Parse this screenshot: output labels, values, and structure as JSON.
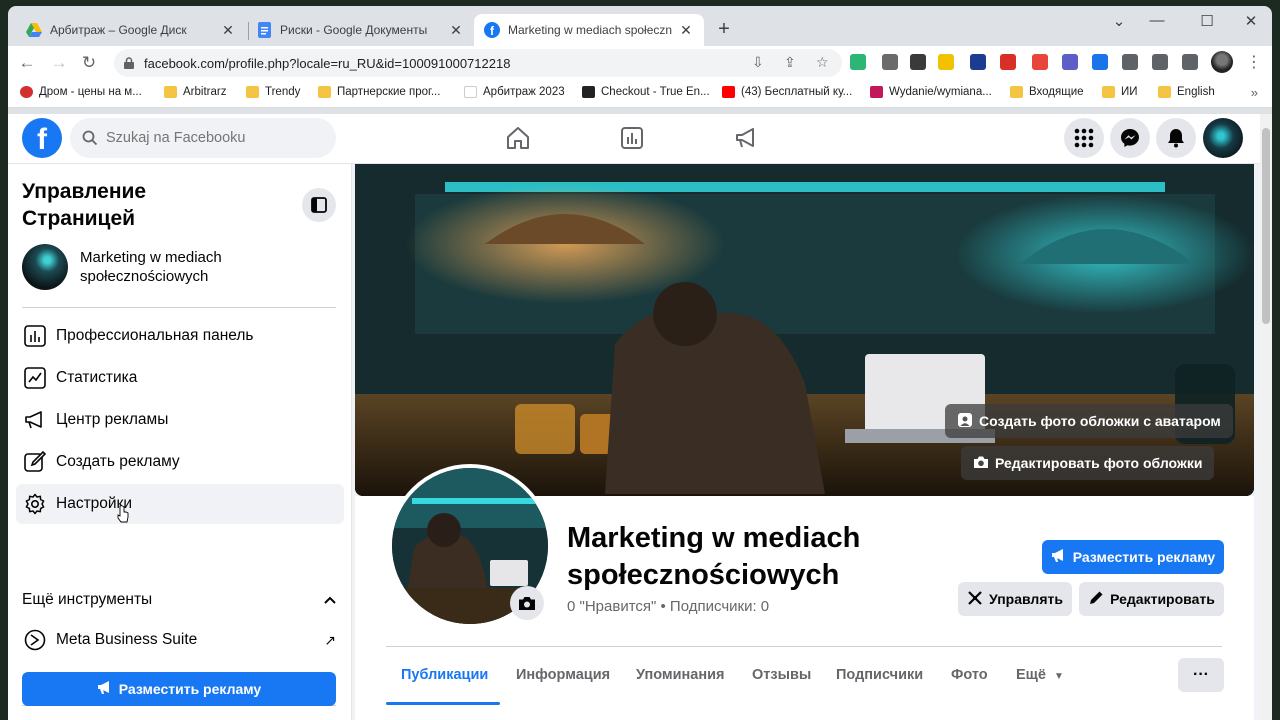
{
  "browser": {
    "tabs": [
      {
        "title": "Арбитраж – Google Диск"
      },
      {
        "title": "Риски - Google Документы"
      },
      {
        "title": "Marketing w mediach społeczności"
      }
    ],
    "url": "facebook.com/profile.php?locale=ru_RU&id=100091000712218",
    "bookmarks": [
      {
        "label": "Дром - цены на м..."
      },
      {
        "label": "Arbitrarz"
      },
      {
        "label": "Trendy"
      },
      {
        "label": "Партнерские прог..."
      },
      {
        "label": "Арбитраж 2023"
      },
      {
        "label": "Checkout - True En..."
      },
      {
        "label": "(43) Бесплатный ку..."
      },
      {
        "label": "Wydanie/wymiana..."
      },
      {
        "label": "Входящие"
      },
      {
        "label": "ИИ"
      },
      {
        "label": "English"
      }
    ]
  },
  "fb": {
    "logo": "f",
    "search_placeholder": "Szukaj na Facebooku"
  },
  "sidebar": {
    "title": "Управление Страницей",
    "page_name": "Marketing w mediach społecznościowych",
    "items": [
      {
        "label": "Профессиональная панель"
      },
      {
        "label": "Статистика"
      },
      {
        "label": "Центр рекламы"
      },
      {
        "label": "Создать рекламу"
      },
      {
        "label": "Настройки"
      }
    ],
    "more_tools": "Ещё инструменты",
    "mbs": "Meta Business Suite",
    "promote": "Разместить рекламу"
  },
  "cover": {
    "avatar_cover_btn": "Создать фото обложки с аватаром",
    "edit_cover_btn": "Редактировать фото обложки"
  },
  "profile": {
    "name": "Marketing w mediach społecznościowych",
    "stats": "0 \"Нравится\" • Подписчики: 0",
    "promote_btn": "Разместить рекламу",
    "manage_btn": "Управлять",
    "edit_btn": "Редактировать",
    "tabs": [
      {
        "label": "Публикации"
      },
      {
        "label": "Информация"
      },
      {
        "label": "Упоминания"
      },
      {
        "label": "Отзывы"
      },
      {
        "label": "Подписчики"
      },
      {
        "label": "Фото"
      },
      {
        "label": "Ещё"
      }
    ],
    "more_dots": "···"
  },
  "colors": {
    "fb_blue": "#1877f2",
    "cover_glow": "#29d3d8"
  }
}
